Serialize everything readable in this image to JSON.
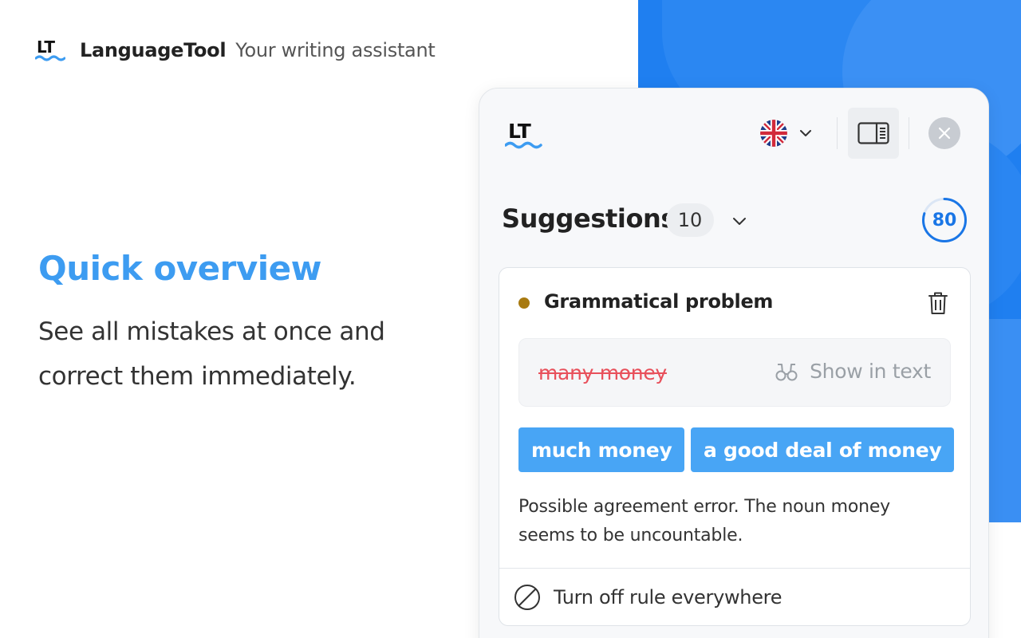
{
  "brand": {
    "name": "LanguageTool",
    "tagline": "Your writing assistant"
  },
  "hero": {
    "headline": "Quick overview",
    "subcopy": "See all mistakes at once and correct them immediately."
  },
  "colors": {
    "accent": "#3d9cf1",
    "chip": "#48a5f5",
    "error": "#e8505b",
    "dot_grammar": "#a87a10",
    "score": "#1a76e6"
  },
  "panel": {
    "language_flag": "uk-flag-icon",
    "suggestions_title": "Suggestions",
    "suggestions_count": "10",
    "score": "80",
    "card": {
      "category": "Grammatical problem",
      "error_text": "many money",
      "show_in_text": "Show in text",
      "replacements": [
        "much money",
        "a good deal of money"
      ],
      "description": "Possible agreement error. The noun money seems to be uncountable.",
      "turn_off": "Turn off rule everywhere"
    }
  }
}
